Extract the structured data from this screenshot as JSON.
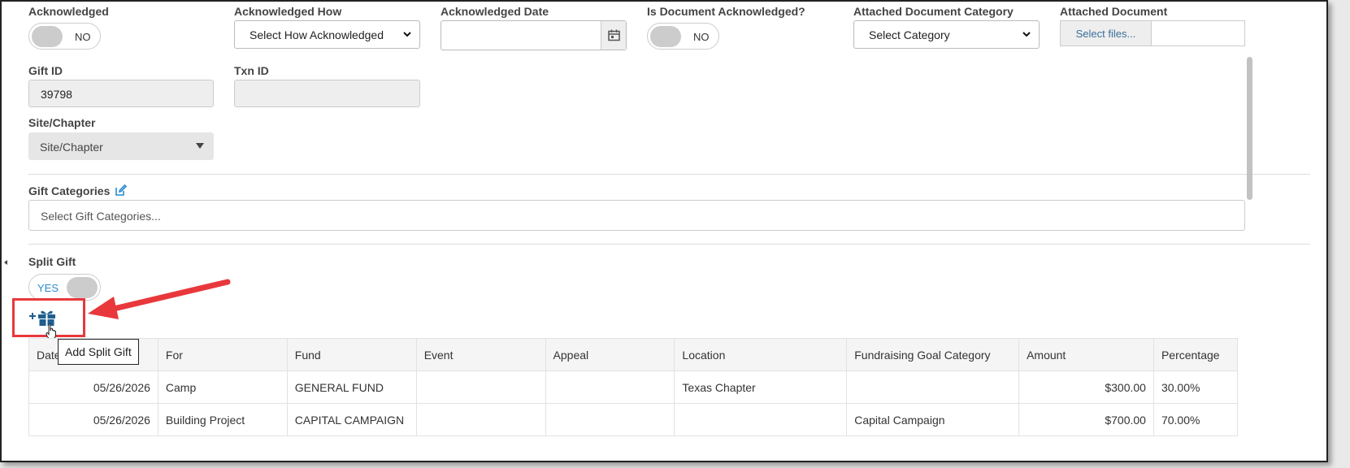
{
  "fields": {
    "acknowledged": {
      "label": "Acknowledged",
      "value": "NO"
    },
    "ack_how": {
      "label": "Acknowledged How",
      "value": "Select How Acknowledged"
    },
    "ack_date": {
      "label": "Acknowledged Date",
      "value": ""
    },
    "doc_ack": {
      "label": "Is Document Acknowledged?",
      "value": "NO"
    },
    "doc_category": {
      "label": "Attached Document Category",
      "value": "Select Category"
    },
    "attached_doc": {
      "label": "Attached Document",
      "button": "Select files..."
    },
    "gift_id": {
      "label": "Gift ID",
      "value": "39798"
    },
    "txn_id": {
      "label": "Txn ID",
      "value": ""
    },
    "site": {
      "label": "Site/Chapter",
      "value": "Site/Chapter"
    },
    "gift_categories": {
      "label": "Gift Categories",
      "placeholder": "Select Gift Categories..."
    },
    "split_gift": {
      "label": "Split Gift",
      "value": "YES"
    }
  },
  "tooltip": "Add Split Gift",
  "colors": {
    "accent": "#2a8bd0",
    "annotation": "#e8383c",
    "icon": "#1f5f8f"
  },
  "table": {
    "headers": [
      "Date",
      "For",
      "Fund",
      "Event",
      "Appeal",
      "Location",
      "Fundraising Goal Category",
      "Amount",
      "Percentage"
    ],
    "rows": [
      [
        "05/26/2026",
        "Camp",
        "GENERAL FUND",
        "",
        "",
        "Texas Chapter",
        "",
        "$300.00",
        "30.00%"
      ],
      [
        "05/26/2026",
        "Building Project",
        "CAPITAL CAMPAIGN",
        "",
        "",
        "",
        "Capital Campaign",
        "$700.00",
        "70.00%"
      ]
    ]
  }
}
